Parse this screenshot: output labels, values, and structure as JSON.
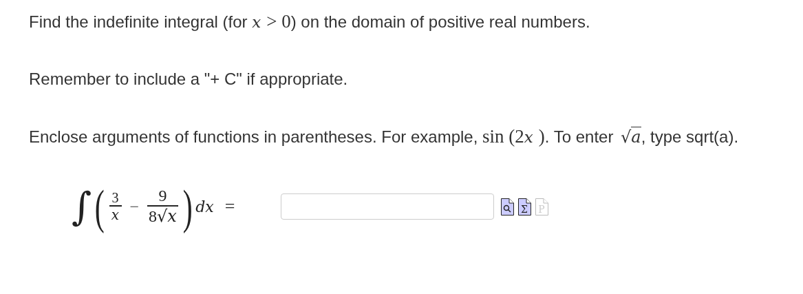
{
  "instructions": [
    {
      "segments": [
        {
          "kind": "text",
          "text": "Find the indefinite integral (for "
        },
        {
          "kind": "math",
          "text": "x"
        },
        {
          "kind": "num",
          "text": "> 0"
        },
        {
          "kind": "text",
          "text": ") on the domain of positive real numbers."
        }
      ]
    },
    {
      "segments": [
        {
          "kind": "text",
          "text": "Remember to include a \"+ C\" if appropriate."
        }
      ]
    },
    {
      "segments": [
        {
          "kind": "text",
          "text": "Enclose arguments of functions in parentheses. For example, "
        },
        {
          "kind": "num",
          "text": "sin"
        },
        {
          "kind": "num",
          "text": " (2"
        },
        {
          "kind": "math",
          "text": "x"
        },
        {
          "kind": "num",
          "text": ")"
        },
        {
          "kind": "text",
          "text": ". To enter "
        },
        {
          "kind": "sqrt",
          "radical": "√",
          "text": "a"
        },
        {
          "kind": "text",
          "text": ", type sqrt(a)."
        }
      ]
    }
  ],
  "formula": {
    "integral": "∫",
    "open": "(",
    "term1": {
      "num": "3",
      "den": "x"
    },
    "minus": "−",
    "term2": {
      "num": "9",
      "den_coef": "8",
      "radical": "√",
      "den_rad": "x"
    },
    "close": ")",
    "differential": "dx",
    "equals": "="
  },
  "answer": {
    "tools": [
      {
        "kind": "preview",
        "disabled": false
      },
      {
        "kind": "equation",
        "glyph": "Σ",
        "disabled": false
      },
      {
        "kind": "paste",
        "glyph": "P",
        "disabled": true
      }
    ]
  }
}
